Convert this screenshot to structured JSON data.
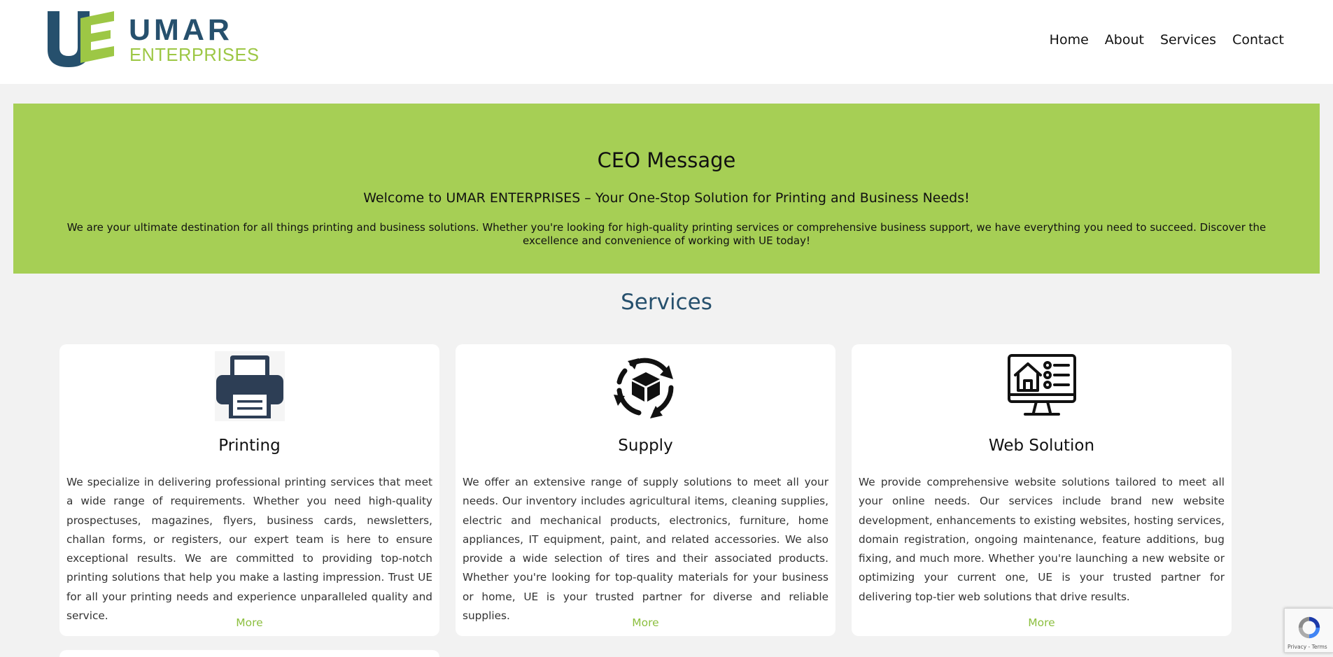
{
  "header": {
    "logo": {
      "mark": "UE",
      "name": "UMAR",
      "sub": "ENTERPRISES"
    },
    "nav": [
      {
        "label": "Home"
      },
      {
        "label": "About"
      },
      {
        "label": "Services"
      },
      {
        "label": "Contact"
      }
    ]
  },
  "ceo": {
    "title": "CEO Message",
    "subtitle": "Welcome to UMAR ENTERPRISES – Your One-Stop Solution for Printing and Business Needs!",
    "body": "We are your ultimate destination for all things printing and business solutions. Whether you're looking for high-quality printing services or comprehensive business support, we have everything you need to succeed. Discover the excellence and convenience of working with UE today!"
  },
  "services": {
    "title": "Services",
    "cards": [
      {
        "icon": "printer-icon",
        "title": "Printing",
        "body": "We specialize in delivering professional printing services that meet a wide range of requirements. Whether you need high-quality prospectuses, magazines, flyers, business cards, newsletters, challan forms, or registers, our expert team is here to ensure exceptional results. We are committed to providing top-notch printing solutions that help you make a lasting impression. Trust UE for all your printing needs and experience unparalleled quality and service.",
        "more": "More"
      },
      {
        "icon": "supply-cycle-icon",
        "title": "Supply",
        "body": "We offer an extensive range of supply solutions to meet all your needs. Our inventory includes agricultural items, cleaning supplies, electric and mechanical products, electronics, furniture, home appliances, IT equipment, paint, and related accessories. We also provide a wide selection of tires and their associated products. Whether you're looking for top-quality materials for your business or home, UE is your trusted partner for diverse and reliable supplies.",
        "more": "More"
      },
      {
        "icon": "web-monitor-icon",
        "title": "Web Solution",
        "body": "We provide comprehensive website solutions tailored to meet all your online needs. Our services include brand new website development, enhancements to existing websites, hosting services, domain registration, ongoing maintenance, feature additions, bug fixing, and much more. Whether you're launching a new website or optimizing your current one, UE is your trusted partner for delivering top-tier web solutions that drive results.",
        "more": "More"
      }
    ]
  },
  "recaptcha": {
    "text": "Privacy - Terms"
  },
  "colors": {
    "brand_green": "#a6cf55",
    "brand_blue": "#26506d",
    "link_green": "#8cbf3f"
  }
}
